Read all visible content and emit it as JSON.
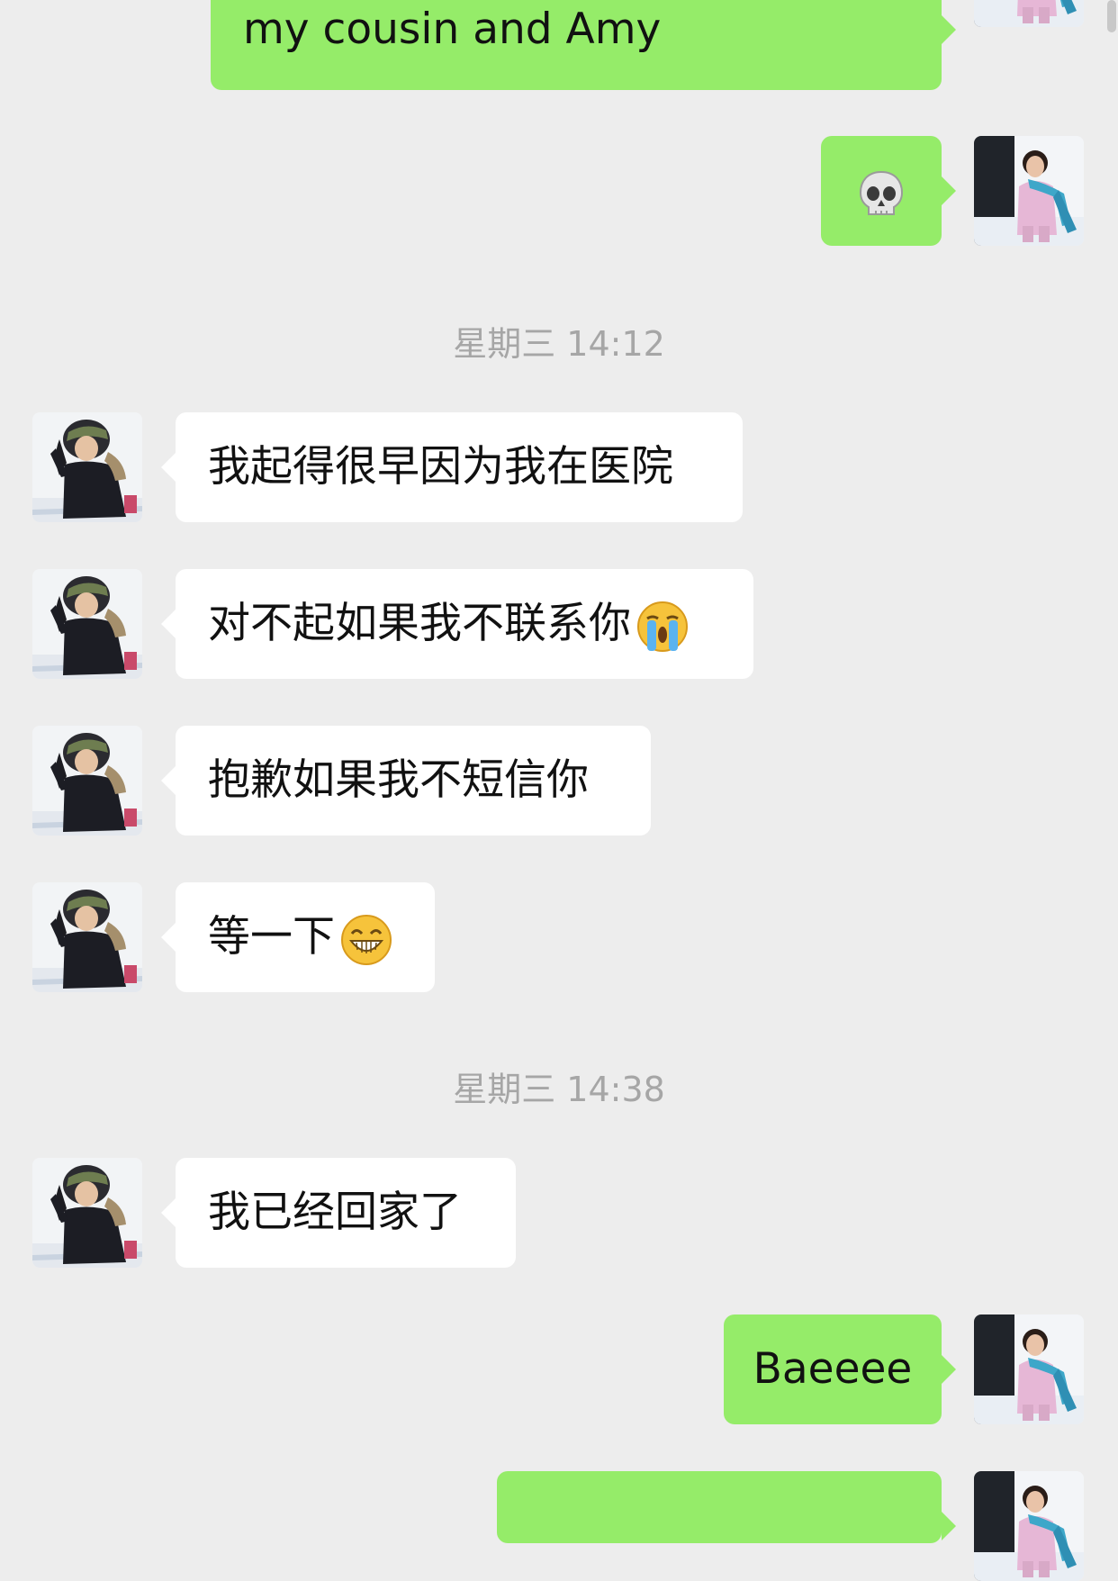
{
  "messages": [
    {
      "side": "me",
      "text": "my cousin and Amy"
    },
    {
      "side": "me",
      "text": "💀"
    },
    {
      "side": "timestamp",
      "text": "星期三 14:12"
    },
    {
      "side": "them",
      "text": "我起得很早因为我在医院"
    },
    {
      "side": "them",
      "text": "对不起如果我不联系你",
      "emoji": "loudly-crying-face"
    },
    {
      "side": "them",
      "text": "抱歉如果我不短信你"
    },
    {
      "side": "them",
      "text": "等一下",
      "emoji": "grinning-face"
    },
    {
      "side": "timestamp",
      "text": "星期三 14:38"
    },
    {
      "side": "them",
      "text": "我已经回家了"
    },
    {
      "side": "me",
      "text": "Baeeee"
    }
  ],
  "colors": {
    "background": "#ededed",
    "my_bubble": "#95ec69",
    "their_bubble": "#ffffff",
    "timestamp_text": "#a6a6a6"
  },
  "icons": {
    "my_avatar": "girl-in-pink-jacket-avatar",
    "their_avatar": "person-in-fur-hood-avatar",
    "skull_emoji": "skull-emoji"
  }
}
